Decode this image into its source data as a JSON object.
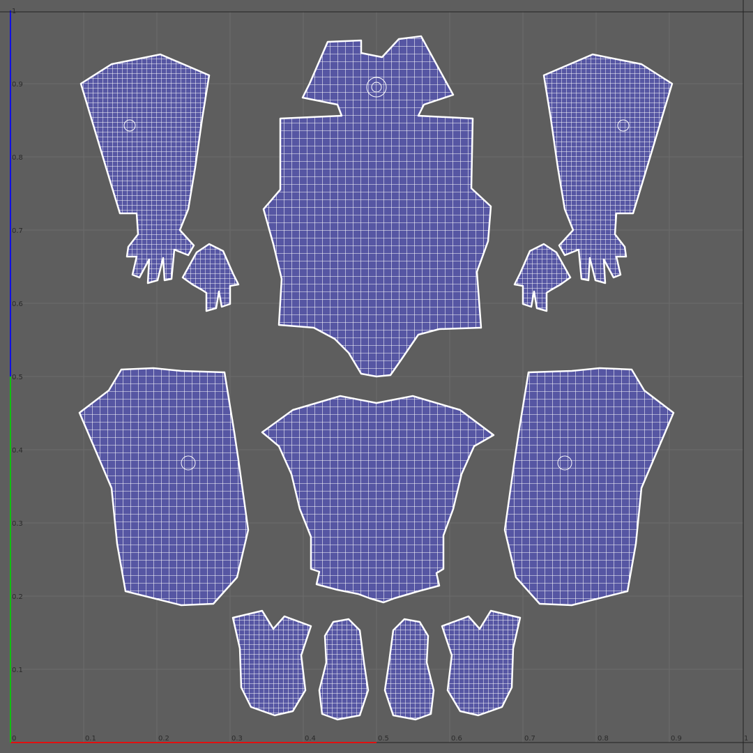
{
  "editor": {
    "axes": {
      "u_ticks": [
        "0",
        "0.1",
        "0.2",
        "0.3",
        "0.4",
        "0.5",
        "0.6",
        "0.7",
        "0.8",
        "0.9",
        "1"
      ],
      "v_ticks": [
        "0.1",
        "0.2",
        "0.3",
        "0.4",
        "0.5",
        "0.6",
        "0.7",
        "0.8",
        "0.9",
        "1"
      ]
    },
    "colors": {
      "background": "#5e5e5e",
      "grid": "#6c6c6c",
      "uv_fill": "#5656a3",
      "uv_wire": "#ffffff",
      "u_axis": "#e01010",
      "v_axis": "#1010e0",
      "v_axis_half": "#10c010"
    },
    "islands": [
      {
        "name": "uv-island-left-sleeve",
        "icon": "arm-island"
      },
      {
        "name": "uv-island-right-sleeve",
        "icon": "arm-island"
      },
      {
        "name": "uv-island-left-hand",
        "icon": "hand-island"
      },
      {
        "name": "uv-island-right-hand",
        "icon": "hand-island"
      },
      {
        "name": "uv-island-torso-front",
        "icon": "torso-island"
      },
      {
        "name": "uv-island-torso-back",
        "icon": "torso-island"
      },
      {
        "name": "uv-island-left-leg",
        "icon": "leg-island"
      },
      {
        "name": "uv-island-right-leg",
        "icon": "leg-island"
      },
      {
        "name": "uv-island-foot-1",
        "icon": "foot-island"
      },
      {
        "name": "uv-island-foot-2",
        "icon": "foot-island"
      },
      {
        "name": "uv-island-foot-3",
        "icon": "foot-island"
      },
      {
        "name": "uv-island-foot-4",
        "icon": "foot-island"
      }
    ]
  }
}
